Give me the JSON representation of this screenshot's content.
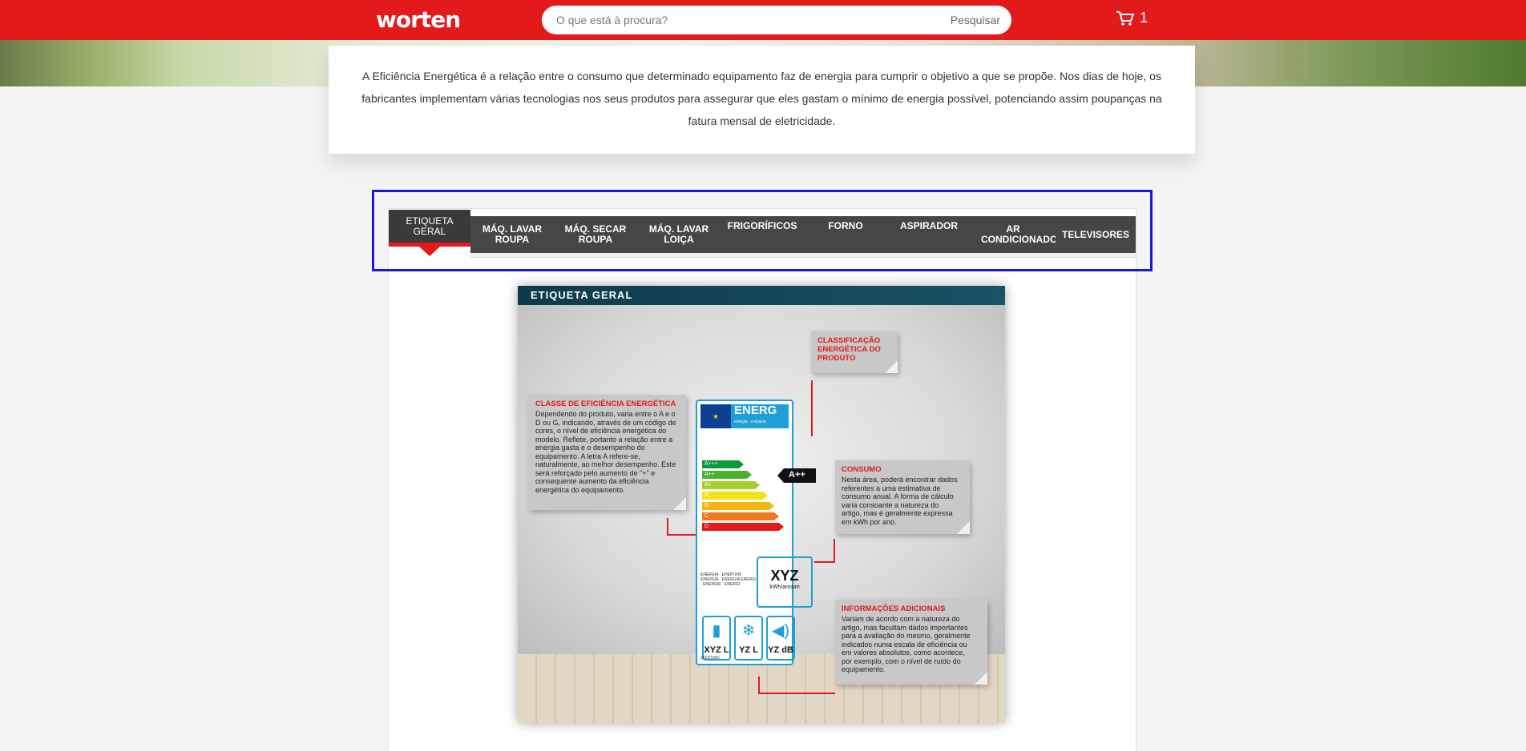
{
  "header": {
    "logo": "worten",
    "search_placeholder": "O que está à procura?",
    "search_button": "Pesquisar",
    "cart_count": "1"
  },
  "intro": {
    "text": "A Eficiência Energética é a relação entre o consumo que determinado equipamento faz de energia para cumprir o objetivo a que se propõe. Nos dias de hoje, os fabricantes implementam várias tecnologias nos seus produtos para assegurar que eles gastam o mínimo de energia possível, potenciando assim poupanças na fatura mensal de eletricidade."
  },
  "tabs": [
    {
      "label": "ETIQUETA GERAL",
      "active": true
    },
    {
      "label": "MÁQ. LAVAR ROUPA"
    },
    {
      "label": "MÁQ. SECAR ROUPA"
    },
    {
      "label": "MÁQ. LAVAR LOIÇA"
    },
    {
      "label": "FRIGORÍFICOS"
    },
    {
      "label": "FORNO"
    },
    {
      "label": "ASPIRADOR"
    },
    {
      "label": "AR CONDICIONADO"
    },
    {
      "label": "TELEVISORES"
    }
  ],
  "figure": {
    "title": "ETIQUETA GERAL",
    "notes": {
      "classificacao": {
        "title": "CLASSIFICAÇÃO ENERGÉTICA DO PRODUTO",
        "text": ""
      },
      "classe": {
        "title": "CLASSE DE EFICIÊNCIA ENERGÉTICA",
        "text": "Dependendo do produto, varia entre o A e o D ou G, indicando, através de um código de cores, o nível de eficiência energética do modelo. Reflete, portanto a relação entre a energia gasta e o desempenho do equipamento. A letra A refere-se, naturalmente, ao melhor desempenho. Este será reforçado pelo aumento de \"+\" e consequente aumento da eficiência energética do equipamento."
      },
      "consumo": {
        "title": "CONSUMO",
        "text": "Nesta área, poderá encontrar dados referentes a uma estimativa de consumo anual. A forma de cálculo varia consoante a natureza do artigo, mas é geralmente expressa em kWh por ano."
      },
      "informacoes": {
        "title": "INFORMAÇÕES ADICIONAIS",
        "text": "Variam de acordo com a natureza do artigo, mas facultam dados importantes para a avaliação do mesmo, geralmente indicados numa escala de eficiência ou em valores absolutos, como acontece, por exemplo, com o nível de ruído do equipamento."
      }
    },
    "label": {
      "energ": "ENERG",
      "energ_sub": "energia · ενέργεια",
      "bars": [
        "A+++",
        "A++",
        "A+",
        "A",
        "B",
        "C",
        "D"
      ],
      "rating": "A++",
      "consumption_value": "XYZ",
      "consumption_unit": "kWh/annum",
      "small_text": "ENERGIA · ЕНЕРГИЯ ENERGIA · ENERGIA ENERGI · ENERGIE · ENERGI",
      "icon_values": [
        "XYZ L",
        "YZ L",
        "YZ dB"
      ],
      "regulation": "2010/1060"
    }
  },
  "colors": {
    "brand_red": "#e3191a",
    "tab_bg": "#464646",
    "focus_outline": "#1a1ad6"
  }
}
